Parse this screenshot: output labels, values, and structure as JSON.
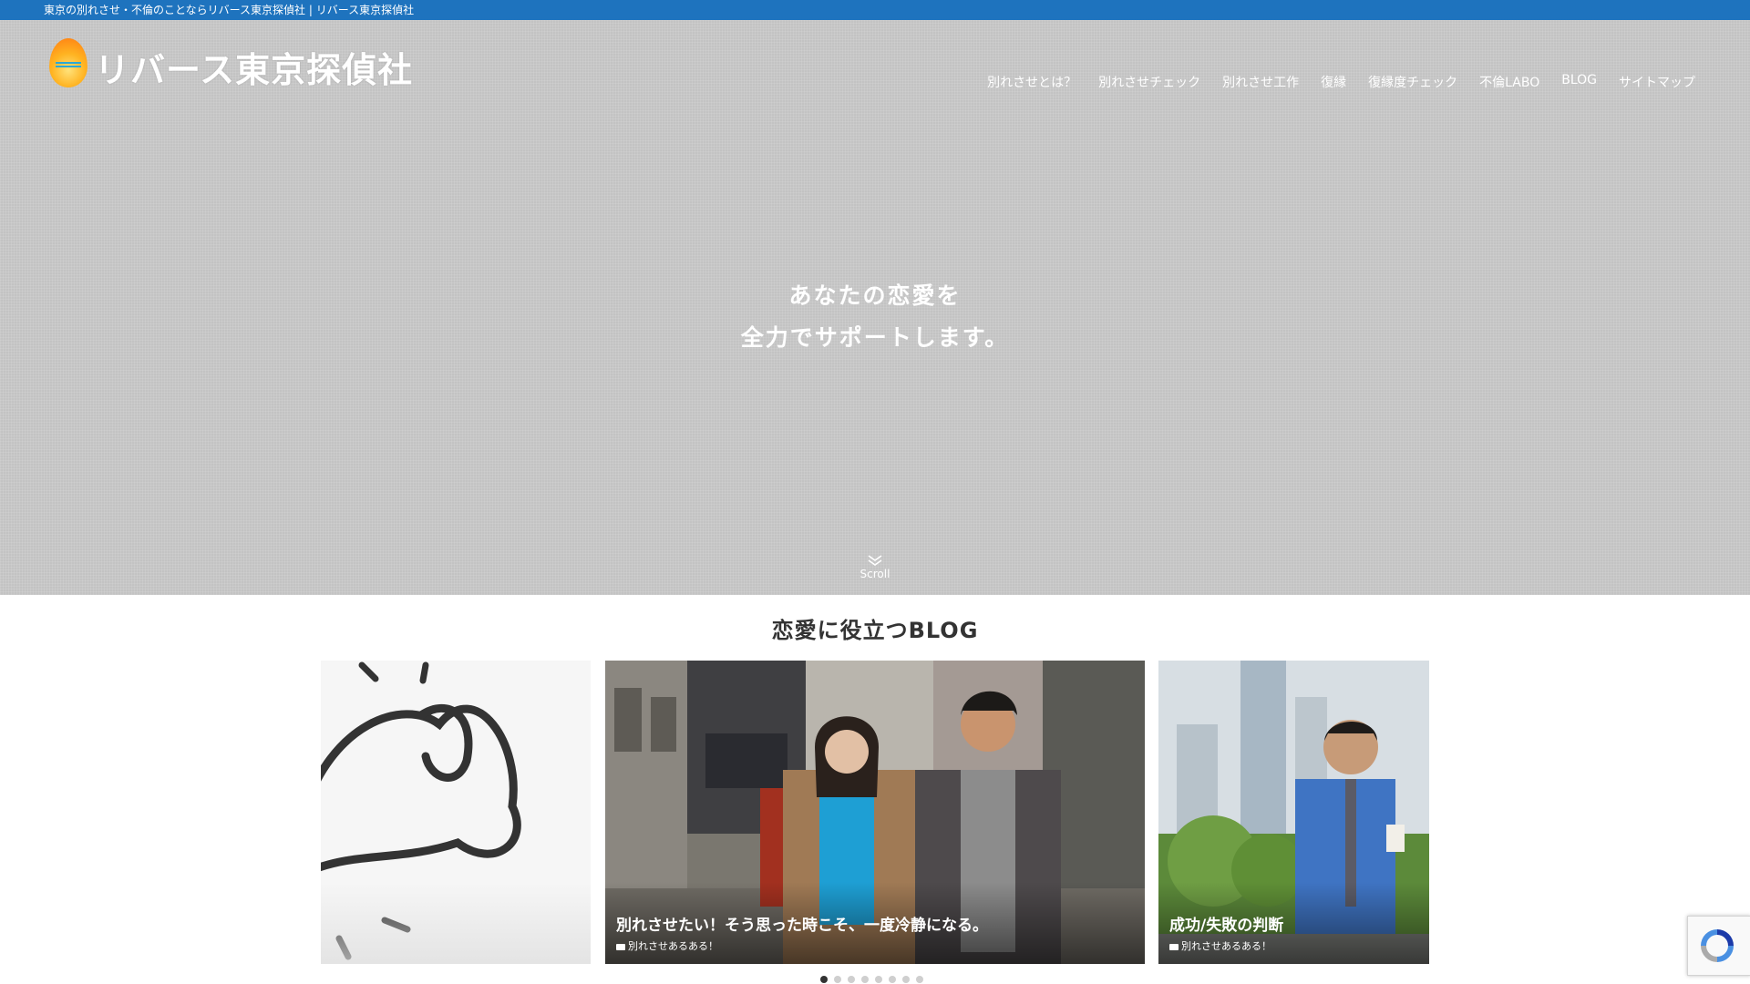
{
  "topbar": {
    "text": "東京の別れさせ・不倫のことならリバース東京探偵社 | リバース東京探偵社"
  },
  "logo": {
    "text": "リバース東京探偵社",
    "icon": "egg-logo-icon"
  },
  "nav": {
    "items": [
      {
        "label": "別れさせとは？"
      },
      {
        "label": "別れさせチェック"
      },
      {
        "label": "別れさせ工作"
      },
      {
        "label": "復縁"
      },
      {
        "label": "復縁度チェック"
      },
      {
        "label": "不倫LABO"
      },
      {
        "label": "BLOG"
      },
      {
        "label": "サイトマップ"
      }
    ]
  },
  "hero": {
    "line1": "あなたの恋愛を",
    "line2": "全力でサポートします。",
    "scroll_label": "Scroll"
  },
  "blog": {
    "heading": "恋愛に役立つBLOG",
    "cards": [
      {
        "title": "",
        "category": ""
      },
      {
        "title": "別れさせたい！そう思った時こそ、一度冷静になる。",
        "category": "別れさせあるある！"
      },
      {
        "title": "成功/失敗の判断",
        "category": "別れさせあるある！"
      }
    ],
    "slider_dots": 8,
    "active_dot": 1
  },
  "colors": {
    "topbar": "#1e73be",
    "hero_bg": "#c3c3c3",
    "text_white": "#ffffff",
    "heading_text": "#333333"
  }
}
